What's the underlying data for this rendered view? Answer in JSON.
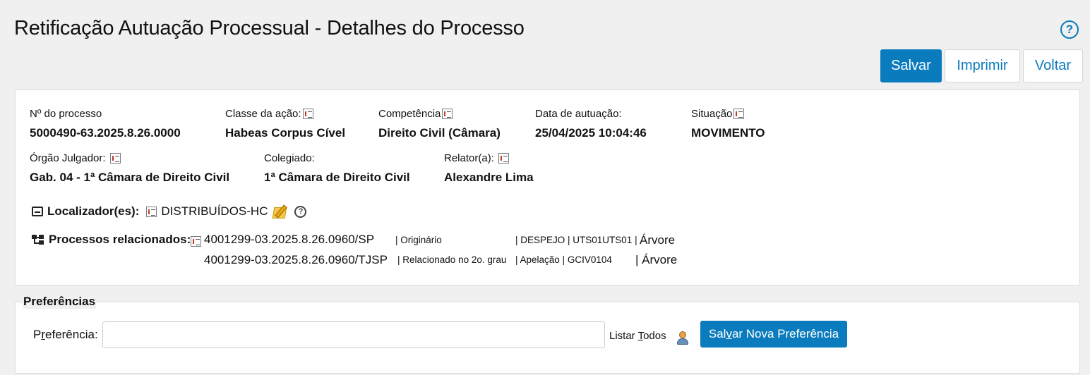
{
  "page": {
    "title": "Retificação Autuação Processual - Detalhes do Processo",
    "help_icon": "question-circle-icon",
    "accent_color": "#0a7bbd"
  },
  "toolbar": {
    "save_label": "Salvar",
    "print_label": "Imprimir",
    "back_label": "Voltar"
  },
  "details": {
    "numero": {
      "label": "Nº do processo",
      "value": "5000490-63.2025.8.26.0000"
    },
    "classe": {
      "label": "Classe da ação:",
      "value": "Habeas Corpus Cível"
    },
    "competencia": {
      "label": "Competência",
      "value": "Direito Civil (Câmara)"
    },
    "data_autuacao": {
      "label": "Data de autuação:",
      "value": "25/04/2025 10:04:46"
    },
    "situacao": {
      "label": "Situação",
      "value": "MOVIMENTO"
    },
    "orgao": {
      "label": "Órgão Julgador:",
      "value": "Gab. 04 - 1ª Câmara de Direito Civil"
    },
    "colegiado": {
      "label": "Colegiado:",
      "value": "1ª Câmara de Direito Civil"
    },
    "relator": {
      "label": "Relator(a):",
      "value": "Alexandre Lima"
    }
  },
  "localizadores": {
    "label": "Localizador(es):",
    "value": "DISTRIBUÍDOS-HC"
  },
  "relacionados": {
    "label": "Processos relacionados:",
    "items": [
      {
        "numero": "4001299-03.2025.8.26.0960/SP",
        "tipo": "| Originário",
        "detalhe": "| DESPEJO | UTS01UTS01 |",
        "link": "Árvore"
      },
      {
        "numero": "4001299-03.2025.8.26.0960/TJSP",
        "tipo": "| Relacionado no 2o. grau",
        "detalhe": "| Apelação | GCIV0104",
        "link": "| Árvore"
      }
    ]
  },
  "preferencias": {
    "legend": "Preferências",
    "label_pre": "P",
    "label_u": "r",
    "label_post": "eferência:",
    "input_value": "",
    "list_pre": "Listar ",
    "list_u": "T",
    "list_post": "odos",
    "save_pre": "Sal",
    "save_u": "v",
    "save_post": "ar Nova Preferência"
  }
}
